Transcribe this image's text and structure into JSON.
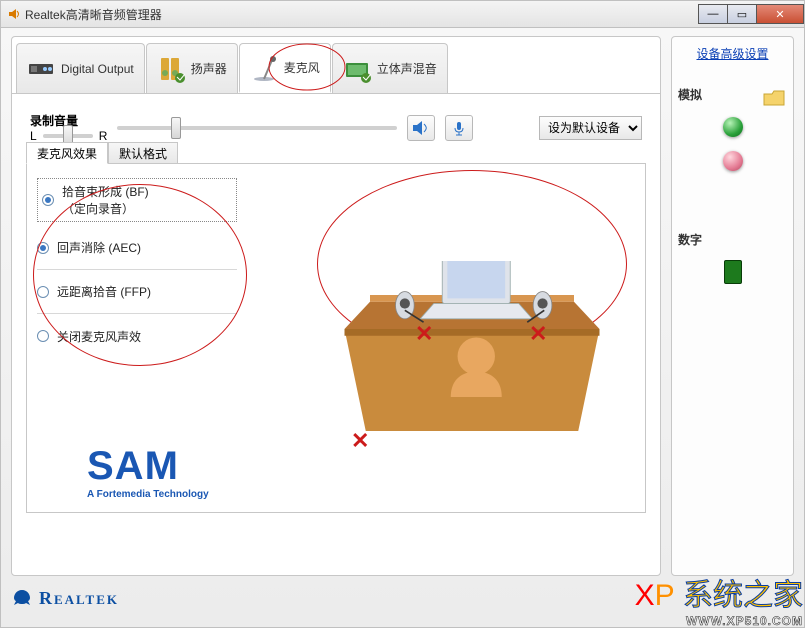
{
  "window": {
    "title": "Realtek高清晰音频管理器"
  },
  "tabs": {
    "digital": "Digital Output",
    "speaker": "扬声器",
    "mic": "麦克风",
    "stereomix": "立体声混音"
  },
  "vol": {
    "label": "录制音量",
    "L": "L",
    "R": "R",
    "default_dev": "设为默认设备"
  },
  "inner_tabs": {
    "fx": "麦克风效果",
    "fmt": "默认格式"
  },
  "opts": {
    "bf": "拾音束形成 (BF)\n（定向录音）",
    "aec": "回声消除 (AEC)",
    "ffp": "远距离拾音 (FFP)",
    "off": "关闭麦克风声效"
  },
  "sam": {
    "name": "SAM",
    "tag": "A Fortemedia Technology"
  },
  "side": {
    "adv": "设备高级设置",
    "analog": "模拟",
    "digital": "数字"
  },
  "footer": {
    "brand": "Realtek"
  },
  "wm": {
    "t1": "X",
    "t2": "P",
    "t3": "系统之家",
    "url": "WWW.XP510.COM"
  }
}
